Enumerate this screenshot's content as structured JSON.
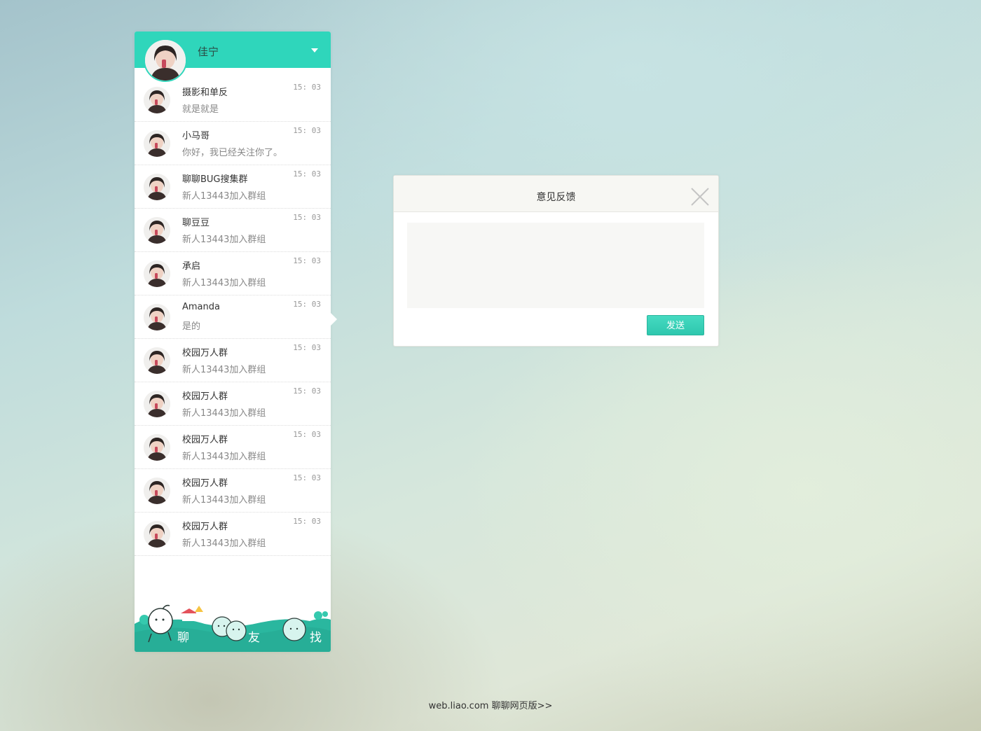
{
  "header": {
    "username": "佳宁"
  },
  "chats": [
    {
      "title": "摄影和单反",
      "preview": "就是就是",
      "time": "15: 03"
    },
    {
      "title": "小马哥",
      "preview": "你好，我已经关注你了。",
      "time": "15: 03"
    },
    {
      "title": "聊聊BUG搜集群",
      "preview": "新人13443加入群组",
      "time": "15: 03"
    },
    {
      "title": "聊豆豆",
      "preview": "新人13443加入群组",
      "time": "15: 03"
    },
    {
      "title": "承启",
      "preview": "新人13443加入群组",
      "time": "15: 03"
    },
    {
      "title": "Amanda",
      "preview": "是的",
      "time": "15: 03"
    },
    {
      "title": "校园万人群",
      "preview": "新人13443加入群组",
      "time": "15: 03"
    },
    {
      "title": "校园万人群",
      "preview": "新人13443加入群组",
      "time": "15: 03"
    },
    {
      "title": "校园万人群",
      "preview": "新人13443加入群组",
      "time": "15: 03"
    },
    {
      "title": "校园万人群",
      "preview": "新人13443加入群组",
      "time": "15: 03"
    },
    {
      "title": "校园万人群",
      "preview": "新人13443加入群组",
      "time": "15: 03"
    }
  ],
  "nav": {
    "chat_label": "聊",
    "friends_label": "友",
    "find_label": "找"
  },
  "dialog": {
    "title": "意见反馈",
    "textarea_value": "",
    "send_label": "发送"
  },
  "footer": {
    "link_text": "web.liao.com 聊聊网页版>>"
  },
  "colors": {
    "accent": "#2fd6bb",
    "nav_bg": "#2cbfa4"
  }
}
